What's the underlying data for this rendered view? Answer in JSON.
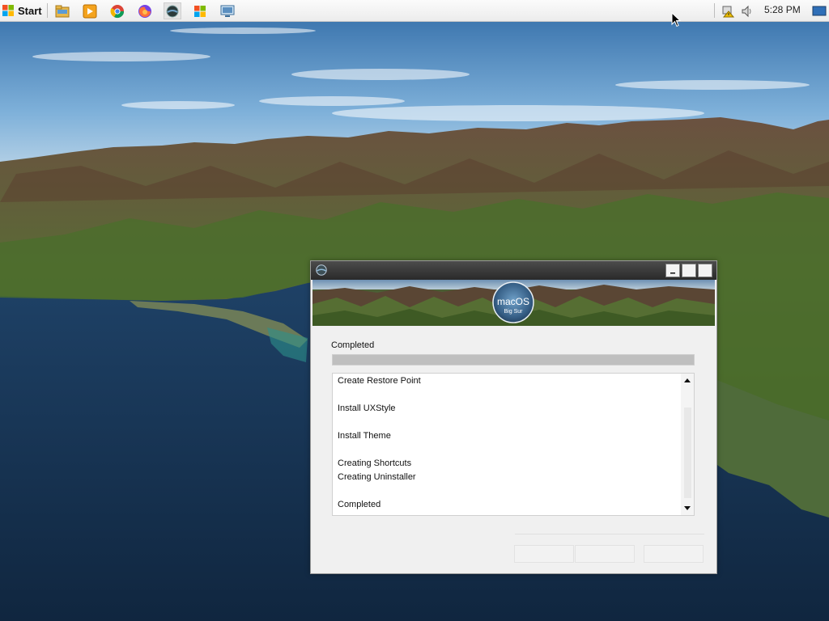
{
  "taskbar": {
    "start_label": "Start",
    "pinned_icons": [
      "file-explorer-icon",
      "media-player-icon",
      "chrome-icon",
      "firefox-icon",
      "macos-transformation-icon",
      "windows-flag-icon",
      "remote-desktop-icon"
    ],
    "tray_icons": [
      "network-warning-icon",
      "volume-icon",
      "show-desktop-icon"
    ],
    "clock": "5:28 PM"
  },
  "installer": {
    "banner": {
      "badge_title": "macOS",
      "badge_subtitle": "Big Sur"
    },
    "status_label": "Completed",
    "progress_percent": 100,
    "log_lines": [
      "Create Restore Point",
      "Install UXStyle",
      "Install Theme",
      "Creating Shortcuts",
      "Creating Uninstaller",
      "Completed"
    ]
  },
  "colors": {
    "titlebar": "#2f2f2f",
    "window_body": "#f0f0f0",
    "progress_fill": "#bfbfbf",
    "taskbar": "#f3f3f3"
  }
}
